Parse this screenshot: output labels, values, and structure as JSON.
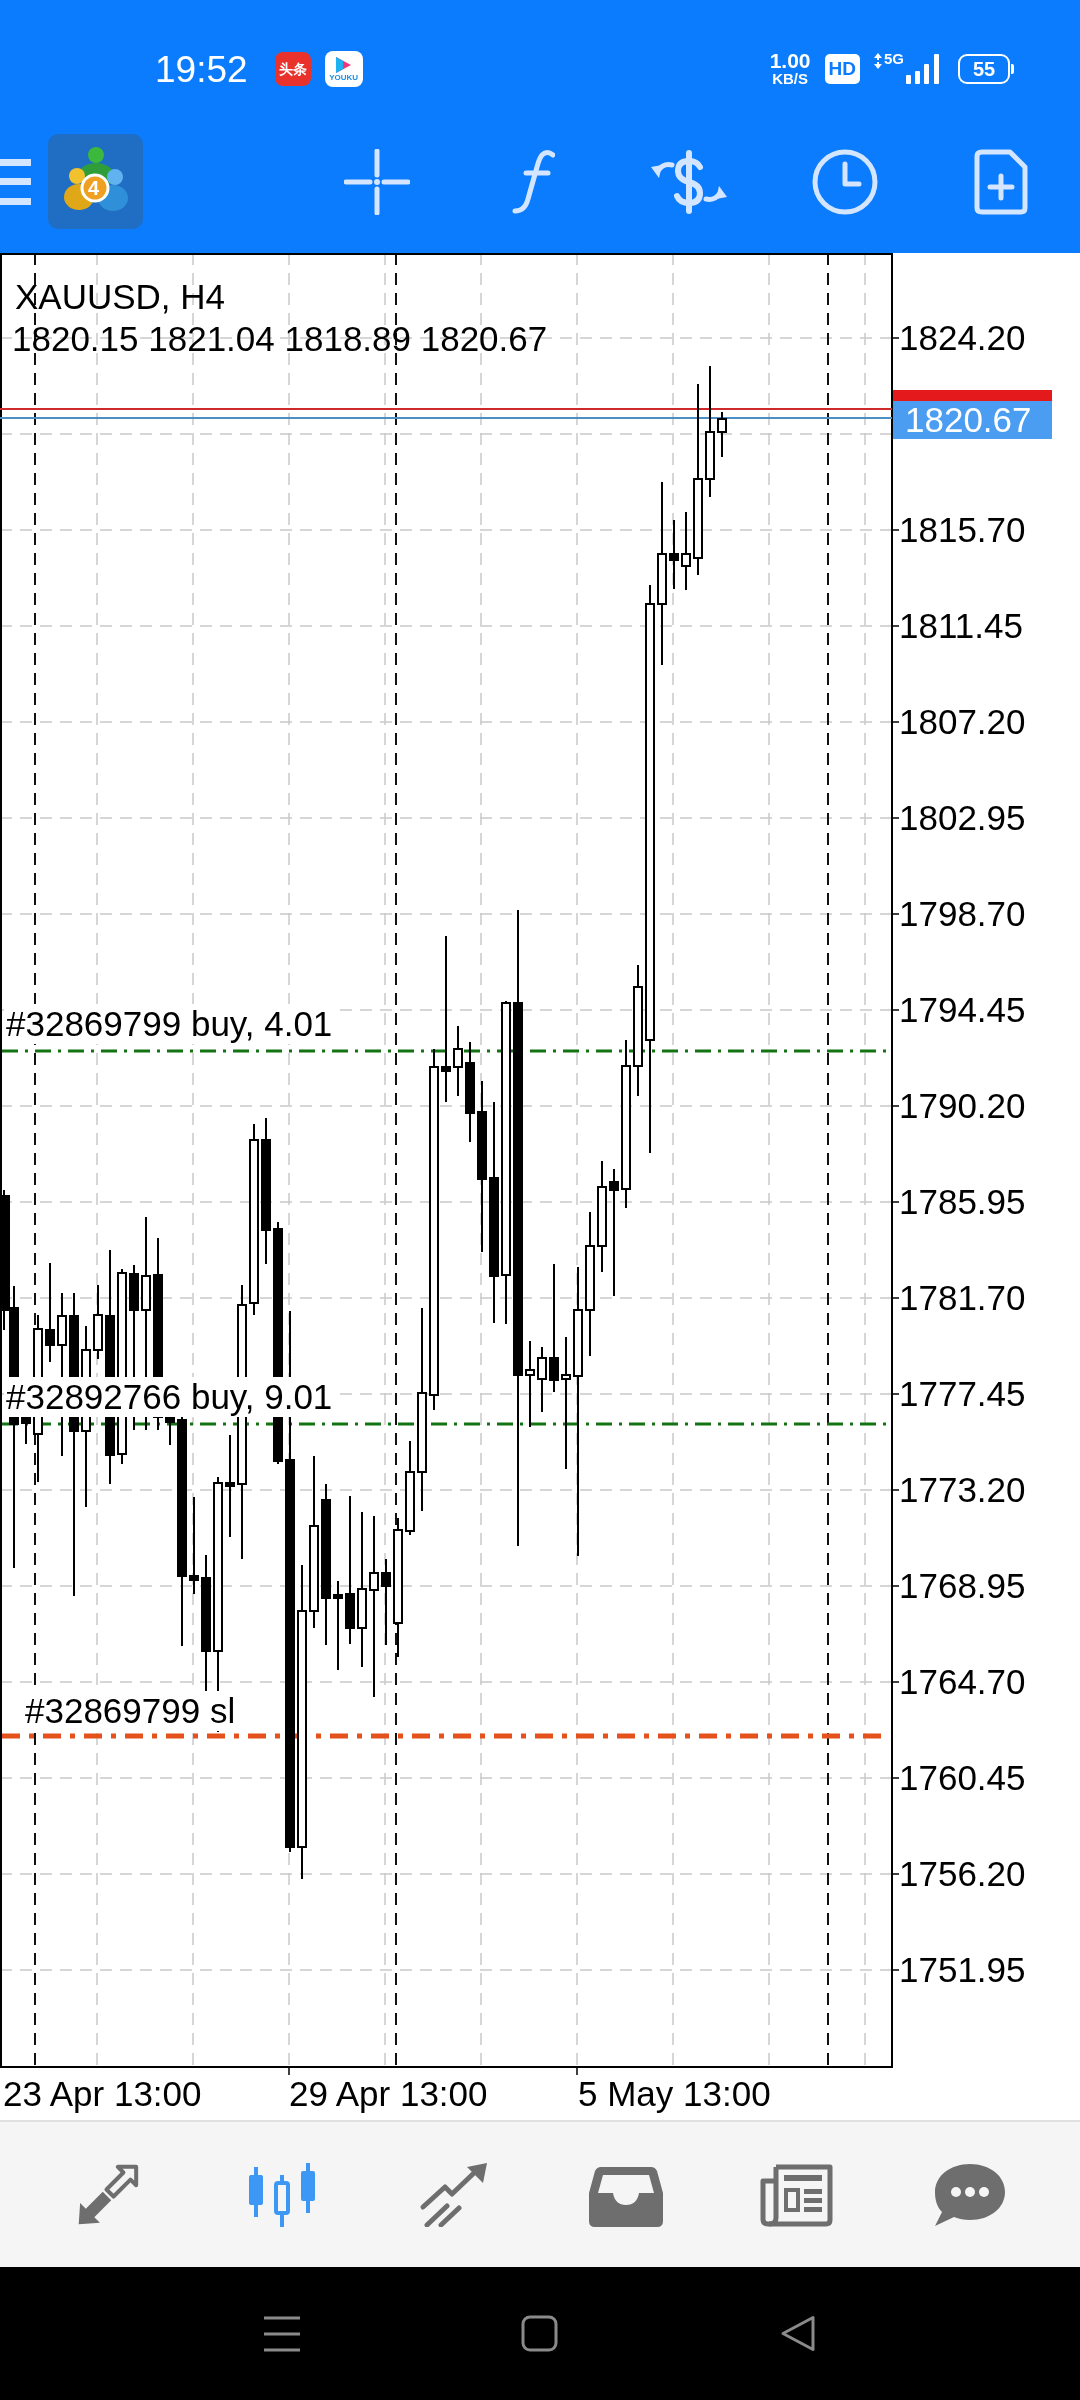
{
  "status_bar": {
    "time": "19:52",
    "app_badges": [
      {
        "kind": "news",
        "label": "头条"
      },
      {
        "kind": "video",
        "label": "YOUKU"
      }
    ],
    "net_speed": "1.00",
    "net_speed_unit": "KB/S",
    "hd": "HD",
    "network": "5G",
    "battery": "55"
  },
  "toolbar": {
    "logo_number": "4"
  },
  "chart": {
    "symbol": "XAUUSD, H4",
    "ohlc": "1820.15 1821.04 1818.89 1820.67",
    "bid_tag": "1820.67",
    "price_axis": [
      "1824.20",
      "1815.70",
      "1811.45",
      "1807.20",
      "1802.95",
      "1798.70",
      "1794.45",
      "1790.20",
      "1785.95",
      "1781.70",
      "1777.45",
      "1773.20",
      "1768.95",
      "1764.70",
      "1760.45",
      "1756.20",
      "1751.95"
    ],
    "orders": [
      {
        "kind": "buy",
        "label": "#32869799 buy, 4.01"
      },
      {
        "kind": "buy",
        "label": "#32892766 buy, 9.01"
      },
      {
        "kind": "sl",
        "label": "#32869799 sl"
      }
    ],
    "time_axis": [
      "23 Apr 13:00",
      "29 Apr 13:00",
      "5 May 13:00"
    ]
  },
  "tab_bar": [
    {
      "selected": false
    },
    {
      "selected": true
    },
    {
      "selected": false
    },
    {
      "selected": false
    },
    {
      "selected": false
    },
    {
      "selected": false
    }
  ]
}
